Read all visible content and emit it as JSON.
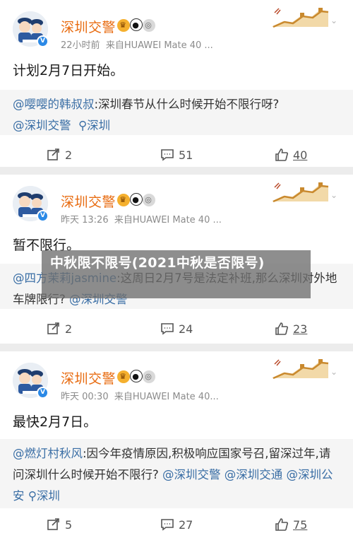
{
  "posts": [
    {
      "username": "深圳交警",
      "time": "22小时前",
      "source": "来自HUAWEI Mate 40 ...",
      "text": "计划2月7日开始。",
      "quote": {
        "author": "@嘤嘤的韩叔叔",
        "body": ":深圳春节从什么时候开始不限行呀?",
        "mention": "@深圳交警",
        "location": "深圳"
      },
      "shares": "2",
      "comments": "51",
      "likes": "40"
    },
    {
      "username": "深圳交警",
      "time": "昨天 13:26",
      "source": "来自HUAWEI Mate 40 ...",
      "text": "暂不限行。",
      "quote": {
        "author": "@四方茉莉jasmine",
        "body": ":这周日2月7号是法定补班,那么深圳对外地车牌限行?",
        "mention": "@深圳交警"
      },
      "shares": "2",
      "comments": "24",
      "likes": "23"
    },
    {
      "username": "深圳交警",
      "time": "昨天 00:30",
      "source": "来自HUAWEI Mate 40...",
      "text": "最快2月7日。",
      "quote": {
        "author": "@燃灯村秋风",
        "body": ":因今年疫情原因,积极响应国家号召,留深过年,请问深圳什么时候开始不限行?",
        "mention1": "@深圳交警",
        "mention2": "@深圳交通",
        "mention3": "@深圳公安",
        "location": "深圳"
      },
      "shares": "5",
      "comments": "27",
      "likes": "75"
    }
  ],
  "overlay_title": "中秋限不限号(2021中秋是否限号)",
  "icons": {
    "verified": "verified-v-icon",
    "vip": "vip-crown-icon",
    "panda": "panda-icon",
    "medal": "medal-icon",
    "header_decoration": "great-wall-icon",
    "more": "chevron-down-icon",
    "share": "share-icon",
    "comment": "comment-icon",
    "like": "thumbs-up-icon",
    "location": "location-pin-icon"
  },
  "colors": {
    "username": "#e86b10",
    "mention": "#3a6ea5",
    "quote_bg": "#f5f5f5",
    "page_bg": "#ececec"
  }
}
